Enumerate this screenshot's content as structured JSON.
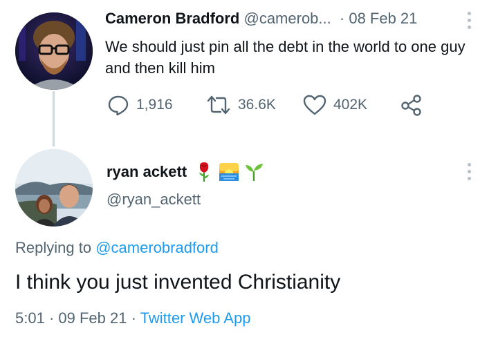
{
  "tweet1": {
    "display_name": "Cameron Bradford",
    "handle": "@camerob...",
    "separator": "·",
    "date": "08 Feb 21",
    "text": "We should just pin all the debt in the world to one guy and then kill him",
    "stats": {
      "replies": "1,916",
      "retweets": "36.6K",
      "likes": "402K"
    }
  },
  "tweet2": {
    "display_name": "ryan ackett",
    "emojis": [
      "rose",
      "sunrise",
      "seedling"
    ],
    "handle": "@ryan_ackett",
    "replying_prefix": "Replying to",
    "replying_handle": "@camerobradford",
    "text": "I think you just invented Christianity",
    "time": "5:01",
    "sep1": "·",
    "date": "09 Feb 21",
    "sep2": "·",
    "source": "Twitter Web App"
  },
  "colors": {
    "accent": "#1d9bf0",
    "muted": "#536471",
    "text": "#0f1419",
    "thread_line": "#cfd9de"
  }
}
